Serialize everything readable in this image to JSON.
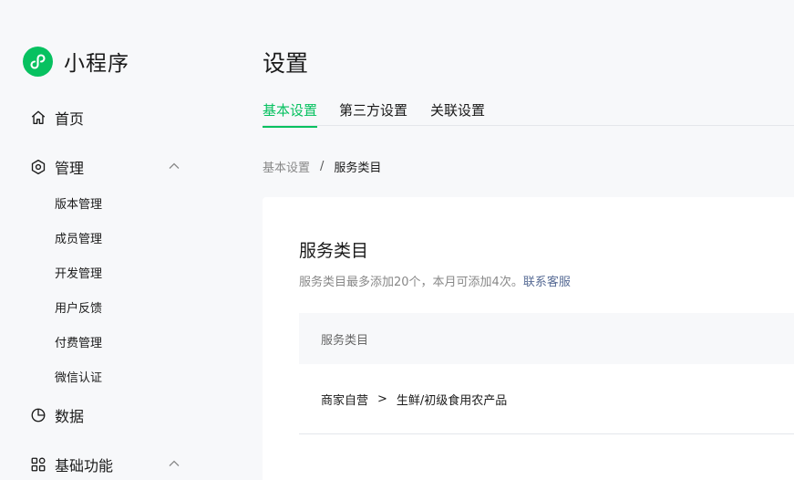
{
  "brand": {
    "name": "小程序",
    "logo_icon": "mini-program-icon",
    "accent": "#07c160"
  },
  "sidebar": {
    "home": {
      "label": "首页",
      "icon": "home-icon"
    },
    "manage": {
      "label": "管理",
      "icon": "hexagon-gear-icon",
      "expanded": true,
      "items": [
        {
          "label": "版本管理"
        },
        {
          "label": "成员管理"
        },
        {
          "label": "开发管理"
        },
        {
          "label": "用户反馈"
        },
        {
          "label": "付费管理"
        },
        {
          "label": "微信认证"
        }
      ]
    },
    "data": {
      "label": "数据",
      "icon": "pie-chart-icon"
    },
    "basic": {
      "label": "基础功能",
      "icon": "grid-icon",
      "expanded": true
    }
  },
  "header": {
    "title": "设置"
  },
  "tabs": [
    {
      "label": "基本设置",
      "active": true
    },
    {
      "label": "第三方设置",
      "active": false
    },
    {
      "label": "关联设置",
      "active": false
    }
  ],
  "breadcrumb": {
    "parent": "基本设置",
    "separator": "/",
    "current": "服务类目"
  },
  "card": {
    "title": "服务类目",
    "description": "服务类目最多添加20个，本月可添加4次。",
    "link": "联系客服",
    "table": {
      "header": "服务类目",
      "rows": [
        {
          "category": "商家自营",
          "arrow": ">",
          "subcategory": "生鲜/初级食用农产品"
        }
      ]
    }
  }
}
